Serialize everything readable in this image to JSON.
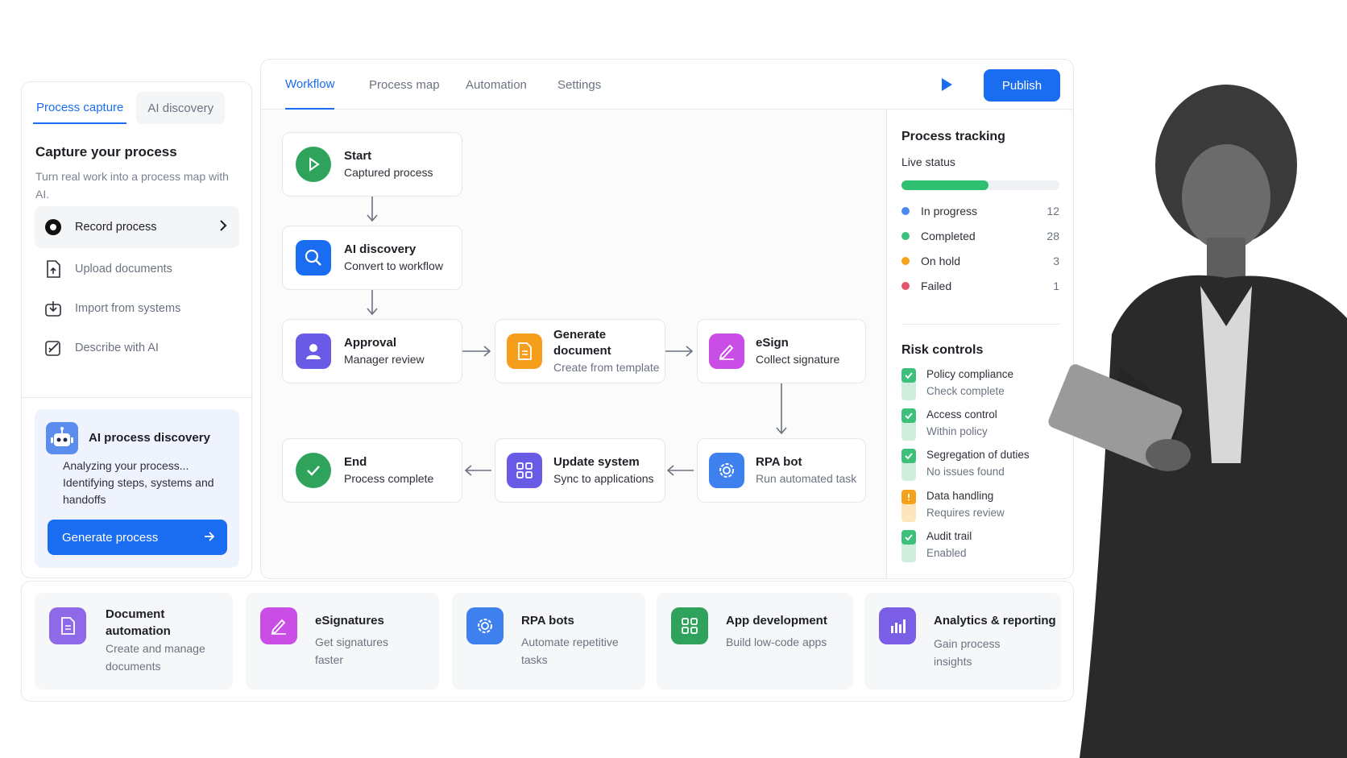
{
  "left": {
    "tabs": [
      "Process capture",
      "AI discovery"
    ],
    "title": "Capture your process",
    "subtitle": "Turn real work into a process map with AI.",
    "items": [
      {
        "label": "Record process",
        "icon": "record-icon"
      },
      {
        "label": "Upload documents",
        "icon": "document-upload-icon"
      },
      {
        "label": "Import from systems",
        "icon": "import-icon"
      },
      {
        "label": "Describe with AI",
        "icon": "ai-pen-icon"
      }
    ],
    "ai_card": {
      "title": "AI process discovery",
      "text": "Analyzing your process... Identifying steps, systems and handoffs",
      "button": "Generate process"
    }
  },
  "main": {
    "tabs": [
      "Workflow",
      "Process map",
      "Automation",
      "Settings"
    ],
    "publish": "Publish",
    "nodes": [
      {
        "title": "Start",
        "sub": "Captured process",
        "icon": "play-icon",
        "color": "#2fa35c"
      },
      {
        "title": "AI discovery",
        "sub": "Convert to workflow",
        "icon": "search-icon",
        "color": "#1a6cf0"
      },
      {
        "title": "Approval",
        "sub": "Manager review",
        "icon": "user-icon",
        "color": "#6a5be6"
      },
      {
        "title": "Generate document",
        "sub": "Create from template",
        "icon": "document-icon",
        "color": "#f59e1b"
      },
      {
        "title": "eSign",
        "sub": "Collect signature",
        "icon": "signature-icon",
        "color": "#c94ee6"
      },
      {
        "title": "RPA bot",
        "sub": "Run automated task",
        "icon": "gear-bot-icon",
        "color": "#3f80ef"
      },
      {
        "title": "Update system",
        "sub": "Sync to applications",
        "icon": "grid-icon",
        "color": "#6a5be6"
      },
      {
        "title": "End",
        "sub": "Process complete",
        "icon": "check-icon",
        "color": "#2fa35c"
      }
    ]
  },
  "tracking": {
    "title": "Process tracking",
    "live": "Live status",
    "progress": 0.55,
    "statuses": [
      {
        "label": "In progress",
        "count": "12",
        "color": "#4a89f0"
      },
      {
        "label": "Completed",
        "count": "28",
        "color": "#3cc07a"
      },
      {
        "label": "On hold",
        "count": "3",
        "color": "#f5a21b"
      },
      {
        "label": "Failed",
        "count": "1",
        "color": "#e5566a"
      }
    ],
    "risk_title": "Risk controls",
    "risks": [
      {
        "title": "Policy compliance",
        "sub": "Check complete",
        "state": "ok"
      },
      {
        "title": "Access control",
        "sub": "Within policy",
        "state": "ok"
      },
      {
        "title": "Segregation of duties",
        "sub": "No issues found",
        "state": "ok"
      },
      {
        "title": "Data handling",
        "sub": "Requires review",
        "state": "warn"
      },
      {
        "title": "Audit trail",
        "sub": "Enabled",
        "state": "ok"
      }
    ]
  },
  "bottom": [
    {
      "title": "Document automation",
      "sub": "Create and manage documents",
      "icon": "document-icon",
      "color": "#8f6ae8"
    },
    {
      "title": "eSignatures",
      "sub": "Get signatures faster",
      "icon": "signature-icon",
      "color": "#c94ee6"
    },
    {
      "title": "RPA bots",
      "sub": "Automate repetitive tasks",
      "icon": "gear-bot-icon",
      "color": "#3f80ef"
    },
    {
      "title": "App development",
      "sub": "Build low-code apps",
      "icon": "grid-icon",
      "color": "#2fa35c"
    },
    {
      "title": "Analytics & reporting",
      "sub": "Gain process insights",
      "icon": "chart-icon",
      "color": "#7a5fe6"
    }
  ]
}
